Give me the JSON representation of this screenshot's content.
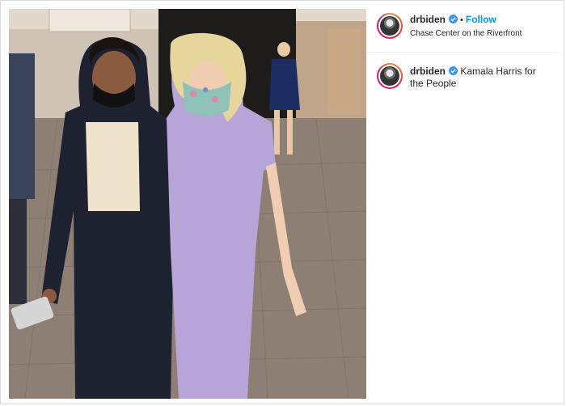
{
  "post": {
    "username": "drbiden",
    "separator": "•",
    "follow_label": "Follow",
    "location": "Chase Center on the Riverfront",
    "caption": "Kamala Harris for the People",
    "verified_icon": "verified-badge-icon",
    "accent": "#0095f6",
    "verified_color": "#3897f0"
  },
  "photo": {
    "subject": "photo",
    "icon": "post-photo"
  }
}
